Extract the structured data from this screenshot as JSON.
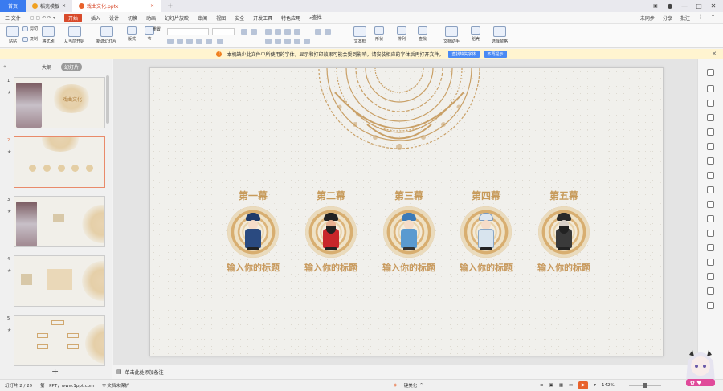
{
  "titlebar": {
    "tabs": [
      {
        "label": "首页"
      },
      {
        "label": "稻壳模板"
      },
      {
        "label": "戏曲文化.pptx"
      }
    ],
    "new_tab": "+",
    "window": [
      "—",
      "□",
      "✕"
    ]
  },
  "menubar": {
    "file": "三 文件",
    "items": [
      "开始",
      "插入",
      "设计",
      "切换",
      "动画",
      "幻灯片放映",
      "审阅",
      "视图",
      "安全",
      "开发工具",
      "特色应用"
    ],
    "search": "查找",
    "right": [
      "未同步",
      "分享",
      "批注"
    ]
  },
  "toolbar": {
    "groups": [
      "粘贴",
      "剪切",
      "复制",
      "格式刷",
      "从当前开始",
      "新建幻灯片",
      "版式",
      "节",
      "重置",
      "文本框",
      "形状",
      "排列",
      "查找",
      "文档助手",
      "稻壳",
      "选择窗格"
    ]
  },
  "notice": {
    "text": "本机缺少此文件中所使用的字体，显示和打印效果可能会受到影响，请安装相应的字体后再打开文件。",
    "buttons": [
      "查找缺失字体",
      "不再提示"
    ]
  },
  "leftpanel": {
    "tabs": [
      "大纲",
      "幻灯片"
    ],
    "slides": [
      {
        "num": "1",
        "title": "戏曲文化"
      },
      {
        "num": "2"
      },
      {
        "num": "3"
      },
      {
        "num": "4"
      },
      {
        "num": "5"
      }
    ],
    "add": "+"
  },
  "slide": {
    "chapters": [
      {
        "title": "第一幕",
        "subtitle": "输入你的标题"
      },
      {
        "title": "第二幕",
        "subtitle": "输入你的标题"
      },
      {
        "title": "第三幕",
        "subtitle": "输入你的标题"
      },
      {
        "title": "第四幕",
        "subtitle": "输入你的标题"
      },
      {
        "title": "第五幕",
        "subtitle": "输入你的标题"
      }
    ]
  },
  "notes": {
    "placeholder": "单击此处添加备注"
  },
  "statusbar": {
    "slide_info": "幻灯片 2 / 29",
    "theme": "第一PPT，www.1ppt.com",
    "protect": "文档未保护",
    "beautify": "一键美化",
    "zoom": "142%"
  },
  "colors": {
    "accent": "#d84a2b",
    "gold": "#c79a5a",
    "home_tab": "#3a7bf0"
  }
}
